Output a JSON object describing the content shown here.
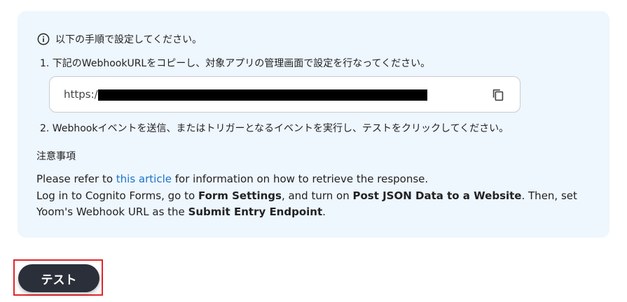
{
  "intro": {
    "text": "以下の手順で設定してください。"
  },
  "steps": [
    {
      "text": "1. 下記のWebhookURLをコピーし、対象アプリの管理画面で設定を行なってください。"
    },
    {
      "text": "2. Webhookイベントを送信、またはトリガーとなるイベントを実行し、テストをクリックしてください。"
    }
  ],
  "webhook": {
    "url_prefix": "https:/"
  },
  "notes": {
    "title": "注意事項",
    "line1_pre": "Please refer to ",
    "line1_link": "this article",
    "line1_post": " for information on how to retrieve the response.",
    "line2_a": "Log in to Cognito Forms, go to ",
    "line2_b": "Form Settings",
    "line2_c": ", and turn on ",
    "line2_d": "Post JSON Data to a Website",
    "line2_e": ". Then, set Yoom's Webhook URL as the ",
    "line2_f": "Submit Entry Endpoint",
    "line2_g": "."
  },
  "test_button": {
    "label": "テスト"
  },
  "colors": {
    "panel_bg": "#eef6fe",
    "link": "#1a73c9",
    "button_bg": "#2a2f3a",
    "highlight_border": "#e0262b"
  },
  "icons": {
    "info": "info-circle-icon",
    "copy": "copy-icon"
  }
}
